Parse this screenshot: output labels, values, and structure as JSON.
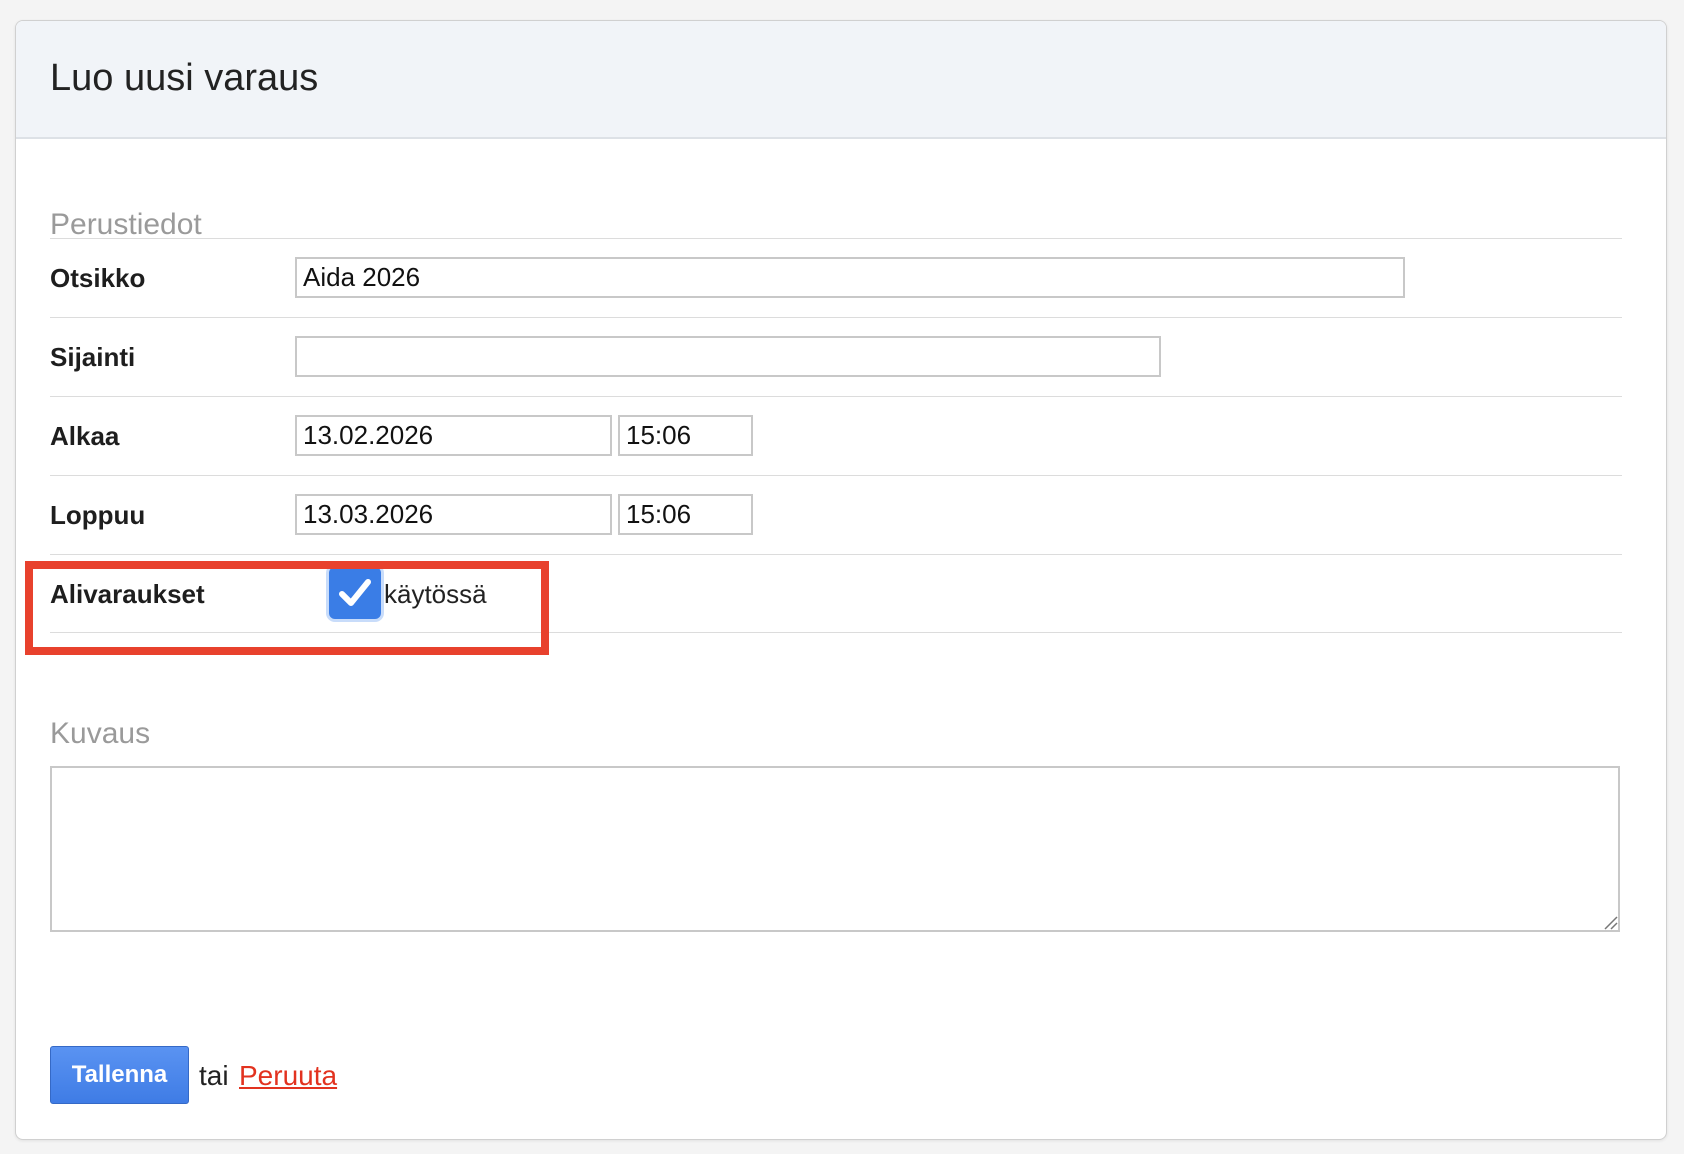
{
  "form": {
    "title": "Luo uusi varaus",
    "sections": {
      "basic": "Perustiedot",
      "description": "Kuvaus"
    },
    "fields": {
      "title": {
        "label": "Otsikko",
        "value": "Aida 2026"
      },
      "location": {
        "label": "Sijainti",
        "value": ""
      },
      "start": {
        "label": "Alkaa",
        "date": "13.02.2026",
        "time": "15:06"
      },
      "end": {
        "label": "Loppuu",
        "date": "13.03.2026",
        "time": "15:06"
      },
      "sub_reservations": {
        "label": "Alivaraukset",
        "checkbox_label": "käytössä",
        "checked": true
      }
    },
    "description_value": "",
    "actions": {
      "save_label": "Tallenna",
      "or_text": "tai",
      "cancel_label": "Peruuta"
    }
  },
  "colors": {
    "highlight": "#e8412d",
    "checkbox": "#3a7de6",
    "save_button": "#4a86ea",
    "cancel_link": "#e2321f"
  },
  "icons": {
    "checkbox": "checkmark-icon",
    "textarea_resize": "resize-grip-icon"
  }
}
